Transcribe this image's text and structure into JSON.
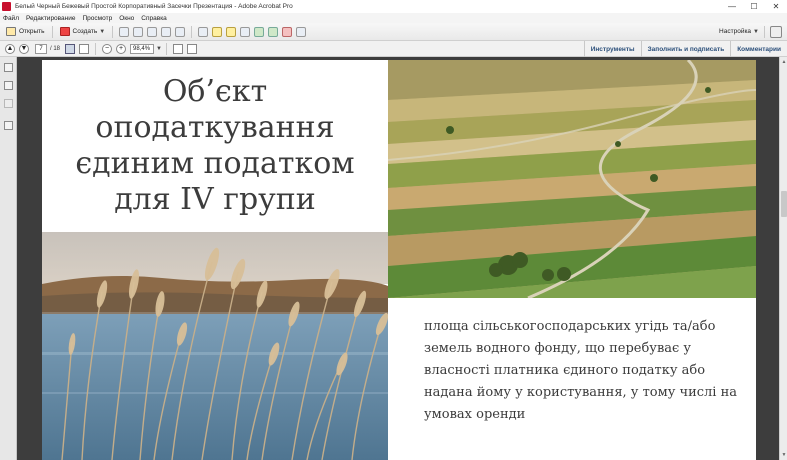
{
  "window": {
    "title": "Белый Черный Бежевый Простой Корпоративный Засечки Презентация - Adobe Acrobat Pro",
    "minimize": "—",
    "maximize": "☐",
    "close": "✕"
  },
  "menu": [
    "Файл",
    "Редактирование",
    "Просмотр",
    "Окно",
    "Справка"
  ],
  "toolbar": {
    "open_label": "Открыть",
    "create_label": "Создать",
    "settings_label": "Настройка"
  },
  "nav": {
    "current_page": "7",
    "total_pages": "/ 18",
    "zoom": "98,4%",
    "prev_symbol": "▲",
    "next_symbol": "▼",
    "zoom_out": "−",
    "zoom_in": "+"
  },
  "right_tabs": {
    "tools": "Инструменты",
    "fill_sign": "Заполнить и подписать",
    "comments": "Комментарии"
  },
  "slide": {
    "title_lines": [
      "Об’єкт",
      "оподаткування",
      "єдиним податком",
      "для IV групи"
    ],
    "description_lines": [
      "площа сільськогосподарських угідь та/або",
      "земель водного фонду, що перебуває у",
      "власності платника єдиного податку або",
      "надана йому у користування, у тому числі на",
      "умовах оренди"
    ]
  },
  "colors": {
    "viewer_bg": "#3d3d3d",
    "link_blue": "#2b4f7a",
    "slide_text": "#3a3a3a"
  }
}
